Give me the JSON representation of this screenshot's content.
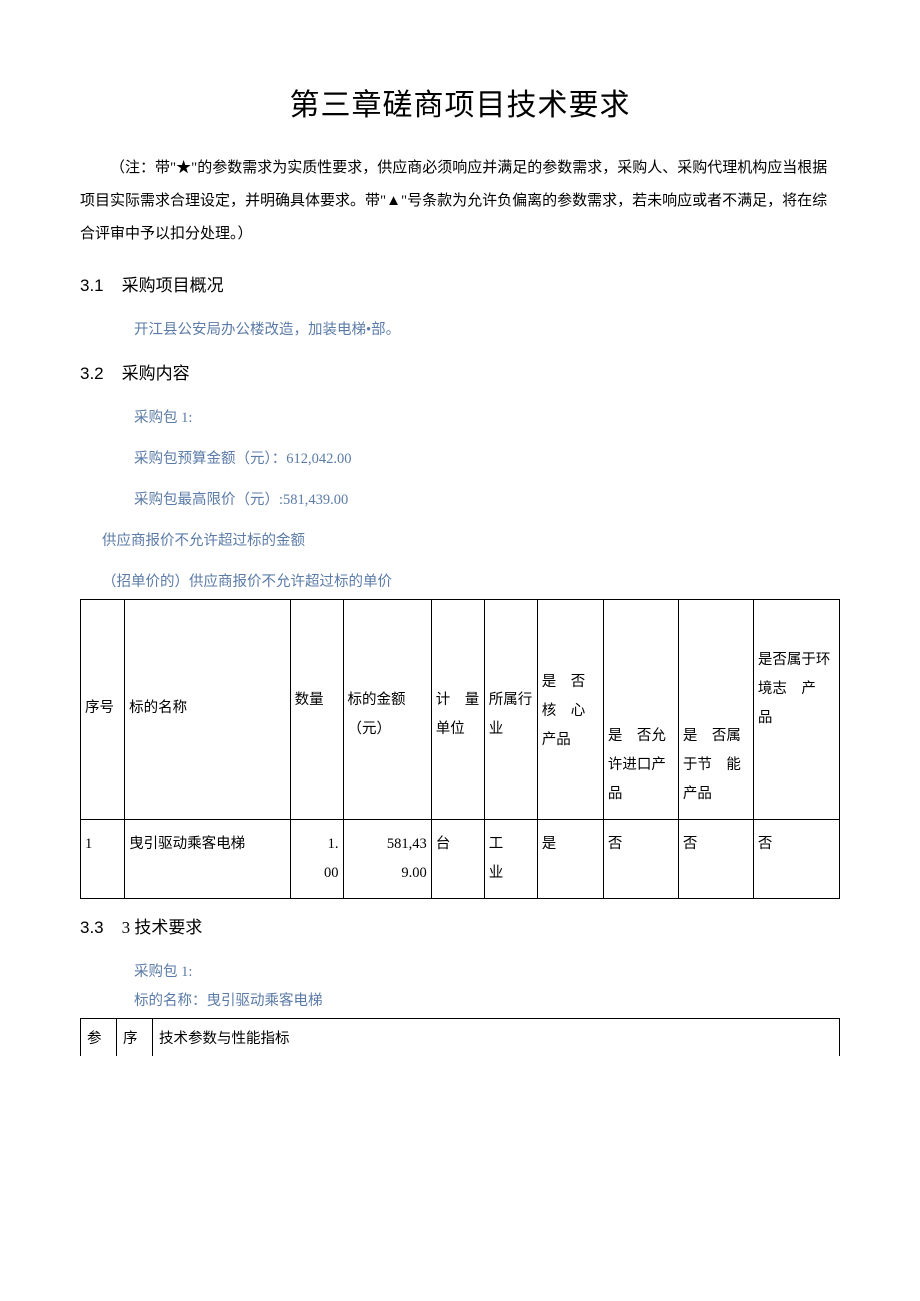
{
  "title": "第三章磋商项目技术要求",
  "note": "（注：带\"★\"的参数需求为实质性要求，供应商必须响应并满足的参数需求，采购人、采购代理机构应当根据项目实际需求合理设定，并明确具体要求。带\"▲\"号条款为允许负偏离的参数需求，若未响应或者不满足，将在综合评审中予以扣分处理。）",
  "s31_num": "3.1",
  "s31_label": "采购项目概况",
  "overview": "开江县公安局办公楼改造，加装电梯•部。",
  "s32_num": "3.2",
  "s32_label": "采购内容",
  "pkg_label": "采购包 1:",
  "budget_line": "采购包预算金额（元）：612,042.00",
  "ceiling_line": "采购包最高限价（元）:581,439.00",
  "rule1": "供应商报价不允许超过标的金额",
  "rule2": "（招单价的）供应商报价不允许超过标的单价",
  "headers": {
    "seq": "序号",
    "name": "标的名称",
    "qty": "数量",
    "amount": "标的金额（元）",
    "unit": "计　量单位",
    "industry": "所属行业",
    "core": "是　否核　心产品",
    "import": "是　否允　许进口产品",
    "energy": "是　否属　于节　能产品",
    "env": "是否属于环境志　产　品"
  },
  "row": {
    "seq": "1",
    "name": "曳引驱动乘客电梯",
    "qty_l1": "1.",
    "qty_l2": "00",
    "amt_l1": "581,43",
    "amt_l2": "9.00",
    "unit": "台",
    "ind_l1": "工",
    "ind_l2": "业",
    "core": "是",
    "import": "否",
    "energy": "否",
    "env": "否"
  },
  "s33_num": "3.3",
  "s33_label": "3 技术要求",
  "pkg_label2": "采购包 1:",
  "bid_name_line": "标的名称：曳引驱动乘客电梯",
  "spec_headers": {
    "c1": "参",
    "c2": "序",
    "c3": "技术参数与性能指标"
  }
}
